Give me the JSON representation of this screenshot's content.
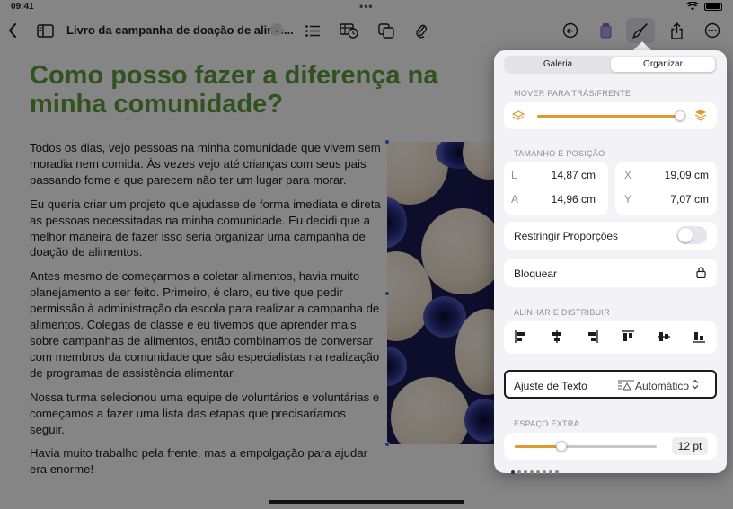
{
  "status_bar": {
    "time": "09:41",
    "dots": "•••"
  },
  "toolbar": {
    "document_title": "Livro da campanha de doação de alime...",
    "title_menu_glyph": "⌄",
    "icons": [
      "back-icon",
      "sidebar-icon",
      "list-icon",
      "table-chart-icon",
      "shapes-icon",
      "attachment-icon",
      "undo-history-icon",
      "format-icon",
      "brush-icon",
      "share-icon",
      "more-icon"
    ]
  },
  "document": {
    "heading": "Como posso fazer a diferença na minha comunidade?",
    "paragraphs": [
      "Todos os dias, vejo pessoas na minha comunidade que vivem sem moradia nem comida. Às vezes vejo até crianças com seus pais passando fome e que parecem não ter um lugar para morar.",
      "Eu queria criar um projeto que ajudasse de forma imediata e direta as pessoas necessitadas na minha comunidade. Eu decidi que a melhor maneira de fazer isso seria organizar uma campanha de doação de alimentos.",
      "Antes mesmo de começarmos a coletar alimentos, havia muito planejamento a ser feito. Primeiro, é claro, eu tive que pedir permissão à administração da escola para realizar a campanha de alimentos. Colegas de classe e eu tivemos que aprender mais sobre campanhas de alimentos, então combinamos de conversar com membros da comunidade que são especialistas na realização de programas de assistência alimentar.",
      "Nossa turma selecionou uma equipe de voluntários e voluntárias e começamos a fazer uma lista das etapas que precisaríamos seguir.",
      "Havia muito trabalho pela frente, mas a empolgação para ajudar era enorme!"
    ]
  },
  "panel": {
    "tabs": [
      {
        "label": "Galeria",
        "selected": false
      },
      {
        "label": "Organizar",
        "selected": true
      }
    ],
    "move": {
      "section_label": "MOVER PARA TRÁS/FRENTE",
      "position_fraction": 0.98
    },
    "size_position": {
      "section_label": "TAMANHO E POSIÇÃO",
      "width_label": "L",
      "width_value": "14,87 cm",
      "height_label": "A",
      "height_value": "14,96 cm",
      "x_label": "X",
      "x_value": "19,09 cm",
      "y_label": "Y",
      "y_value": "7,07 cm"
    },
    "constrain": {
      "label": "Restringir Proporções",
      "on": false
    },
    "lock": {
      "label": "Bloquear"
    },
    "align": {
      "section_label": "ALINHAR E DISTRIBUIR",
      "buttons": [
        "align-left-icon",
        "align-center-icon",
        "align-right-icon",
        "align-top-icon",
        "align-middle-icon",
        "align-bottom-icon"
      ]
    },
    "text_wrap": {
      "label": "Ajuste de Texto",
      "value": "Automático",
      "chevron": "⌃⌄"
    },
    "extra_space": {
      "section_label": "ESPAÇO EXTRA",
      "value": "12 pt",
      "fraction": 0.33
    }
  },
  "colors": {
    "heading_green": "#5a9e3a",
    "slider_orange": "#e19a2c",
    "selection_blue": "#3b6fe0"
  }
}
